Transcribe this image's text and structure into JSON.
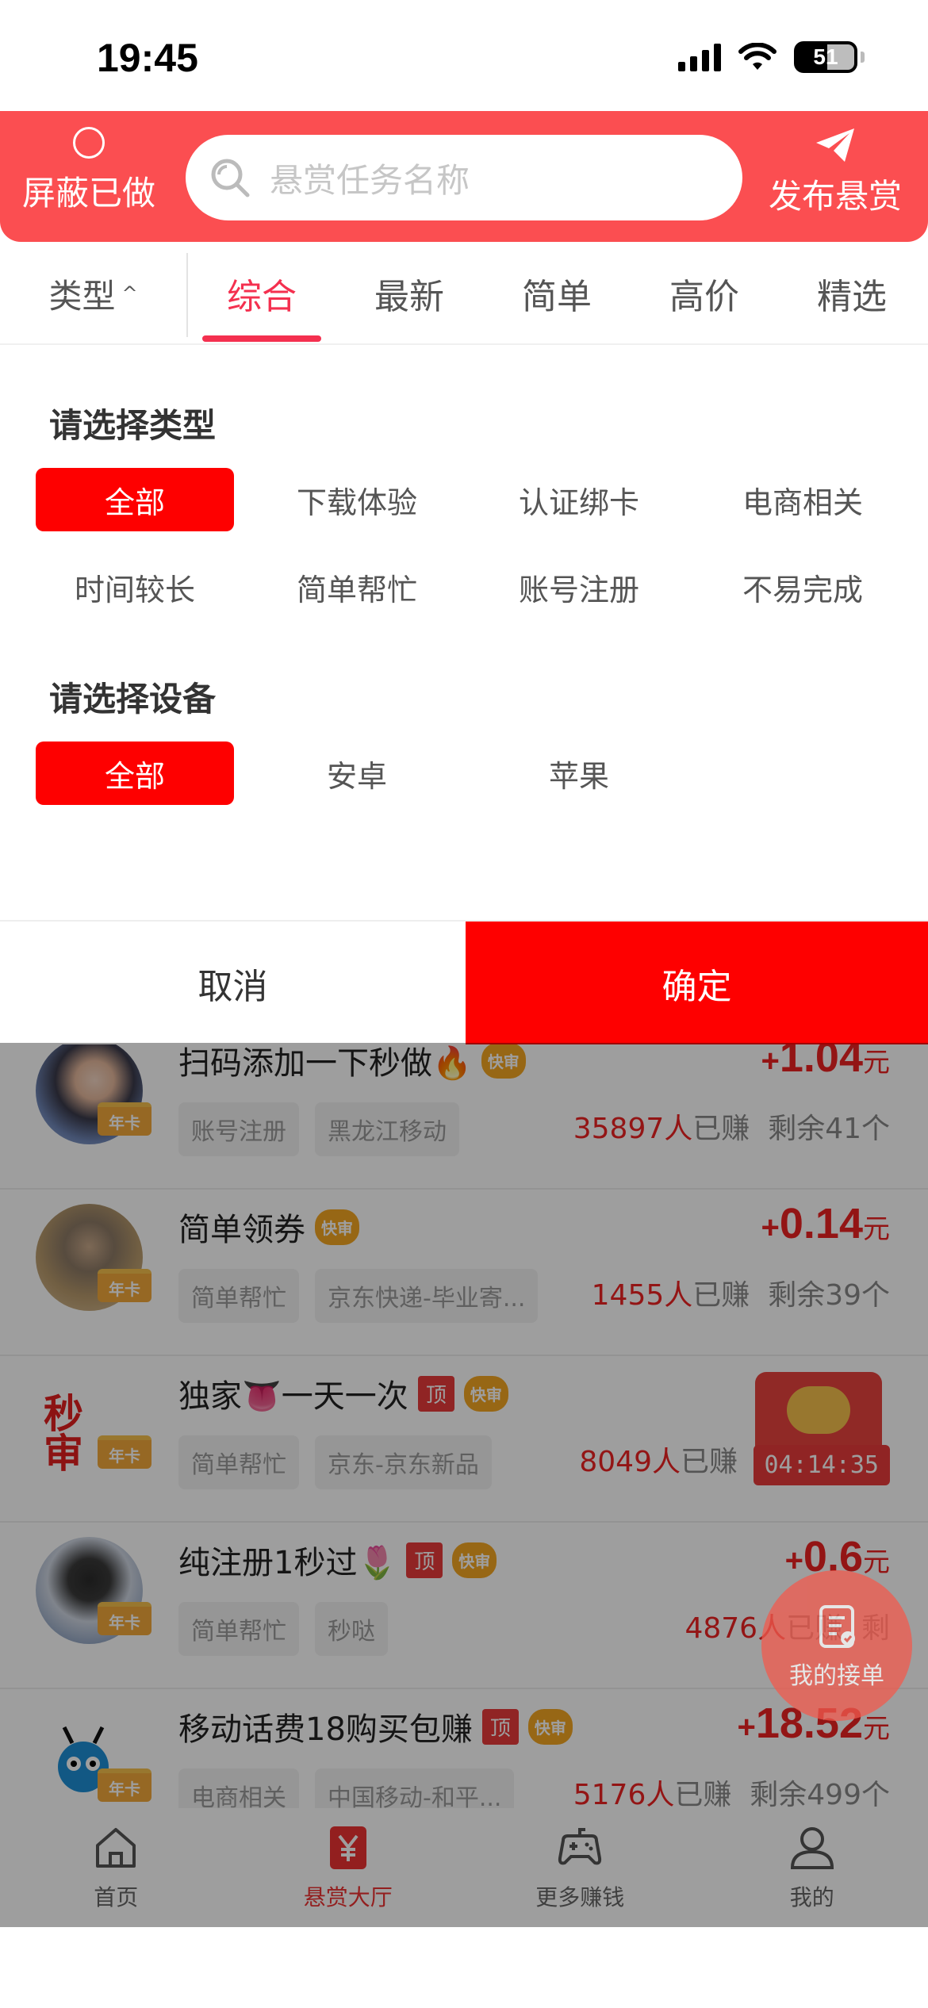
{
  "status": {
    "time": "19:45",
    "battery": "51"
  },
  "header": {
    "hide_done": "屏蔽已做",
    "search_placeholder": "悬赏任务名称",
    "publish": "发布悬赏"
  },
  "tabs": {
    "type_filter": "类型",
    "items": [
      "综合",
      "最新",
      "简单",
      "高价",
      "精选"
    ],
    "active_index": 0
  },
  "filter": {
    "type_title": "请选择类型",
    "type_options": [
      "全部",
      "下载体验",
      "认证绑卡",
      "电商相关",
      "时间较长",
      "简单帮忙",
      "账号注册",
      "不易完成"
    ],
    "device_title": "请选择设备",
    "device_options": [
      "全部",
      "安卓",
      "苹果"
    ],
    "cancel": "取消",
    "confirm": "确定"
  },
  "tasks": [
    {
      "title": "扫码添加一下秒做🔥",
      "tags": [
        "账号注册",
        "黑龙江移动"
      ],
      "price": "1.04",
      "unit": "元",
      "earned": "35897人",
      "earned_suffix": "已赚",
      "remaining": "剩余41个",
      "badge": "年卡",
      "top": false,
      "fast": "快审"
    },
    {
      "title": "简单领券",
      "tags": [
        "简单帮忙",
        "京东快递-毕业寄..."
      ],
      "price": "0.14",
      "unit": "元",
      "earned": "1455人",
      "earned_suffix": "已赚",
      "remaining": "剩余39个",
      "badge": "年卡",
      "top": false,
      "fast": "快审"
    },
    {
      "title": "独家👅一天一次",
      "tags": [
        "简单帮忙",
        "京东-京东新品"
      ],
      "price": "",
      "unit": "",
      "earned": "8049人",
      "earned_suffix": "已赚",
      "remaining": "",
      "badge": "年卡",
      "top": "顶",
      "fast": "快审",
      "logo": "秒审",
      "timer": "04:14:35"
    },
    {
      "title": "纯注册1秒过🌷",
      "tags": [
        "简单帮忙",
        "秒哒"
      ],
      "price": "0.6",
      "unit": "元",
      "earned": "4876人",
      "earned_suffix": "已赚",
      "remaining": "剩",
      "badge": "年卡",
      "top": "顶",
      "fast": "快审"
    },
    {
      "title": "移动话费18购买包赚",
      "tags": [
        "电商相关",
        "中国移动-和平..."
      ],
      "price": "18.52",
      "unit": "元",
      "earned": "5176人",
      "earned_suffix": "已赚",
      "remaining": "剩余499个",
      "badge": "年卡",
      "top": "顶",
      "fast": "快审"
    }
  ],
  "fab": {
    "label": "我的接单"
  },
  "nav": {
    "home": "首页",
    "hall": "悬赏大厅",
    "more": "更多赚钱",
    "mine": "我的"
  },
  "colors": {
    "brand_red": "#fb4e51",
    "confirm_red": "#fe0000",
    "tab_active": "#f4304f"
  }
}
